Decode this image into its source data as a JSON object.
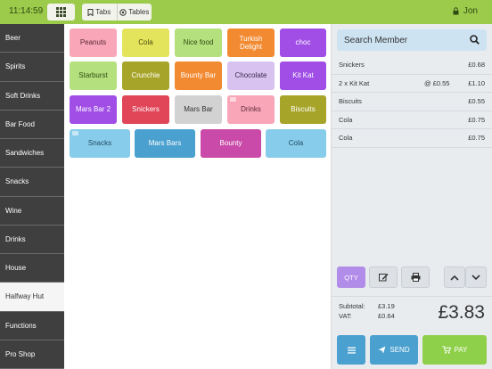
{
  "topbar": {
    "time": "11:14:59",
    "tabs_label": "Tabs",
    "tables_label": "Tables",
    "user_name": "Jon"
  },
  "sidebar": {
    "items": [
      {
        "label": "Beer"
      },
      {
        "label": "Spirits"
      },
      {
        "label": "Soft Drinks"
      },
      {
        "label": "Bar Food"
      },
      {
        "label": "Sandwiches"
      },
      {
        "label": "Snacks"
      },
      {
        "label": "Wine"
      },
      {
        "label": "Drinks"
      },
      {
        "label": "House"
      },
      {
        "label": "Halfway Hut",
        "active": true
      },
      {
        "label": "Functions"
      },
      {
        "label": "Pro Shop"
      }
    ]
  },
  "products": [
    {
      "label": "Peanuts",
      "color": "#f9a6b8",
      "text": "#5a2a35"
    },
    {
      "label": "Cola",
      "color": "#e4e45c",
      "text": "#4a4a10"
    },
    {
      "label": "Nice food",
      "color": "#b4e07e",
      "text": "#2f4a10"
    },
    {
      "label": "Turkish Delight",
      "color": "#f28a32",
      "text": "#ffffff"
    },
    {
      "label": "choc",
      "color": "#a04ee6",
      "text": "#ffffff"
    },
    {
      "label": "Starburst",
      "color": "#b4e07e",
      "text": "#2f4a10"
    },
    {
      "label": "Crunchie",
      "color": "#a7a42a",
      "text": "#ffffff"
    },
    {
      "label": "Bounty Bar",
      "color": "#f28a32",
      "text": "#ffffff"
    },
    {
      "label": "Chocolate",
      "color": "#d8c2ef",
      "text": "#3a2a50"
    },
    {
      "label": "Kit Kat",
      "color": "#a04ee6",
      "text": "#ffffff"
    },
    {
      "label": "Mars Bar 2",
      "color": "#a04ee6",
      "text": "#ffffff"
    },
    {
      "label": "Snickers",
      "color": "#e04558",
      "text": "#ffffff"
    },
    {
      "label": "Mars Bar",
      "color": "#d2d2d2",
      "text": "#333333"
    },
    {
      "label": "Drinks",
      "color": "#f9a6b8",
      "text": "#5a2a35",
      "folder": true
    },
    {
      "label": "Biscuits",
      "color": "#a7a42a",
      "text": "#ffffff"
    },
    {
      "label": "Snacks",
      "color": "#88cceb",
      "text": "#1f4a60",
      "folder": true
    },
    {
      "label": "Mars Bars",
      "color": "#4aa0cf",
      "text": "#ffffff"
    },
    {
      "label": "Bounty",
      "color": "#c94aa8",
      "text": "#ffffff"
    },
    {
      "label": "Cola",
      "color": "#88cceb",
      "text": "#1f4a60"
    }
  ],
  "order": {
    "search_placeholder": "Search Member",
    "lines": [
      {
        "desc": "Snickers",
        "unit": "",
        "amount": "£0.68"
      },
      {
        "desc": "2 x  Kit Kat",
        "unit": "@ £0.55",
        "amount": "£1.10"
      },
      {
        "desc": "Biscuits",
        "unit": "",
        "amount": "£0.55"
      },
      {
        "desc": "Cola",
        "unit": "",
        "amount": "£0.75"
      },
      {
        "desc": "Cola",
        "unit": "",
        "amount": "£0.75"
      }
    ],
    "qty_label": "QTY",
    "subtotal_label": "Subtotal:",
    "subtotal_value": "£3.19",
    "vat_label": "VAT:",
    "vat_value": "£0.64",
    "total": "£3.83",
    "send_label": "SEND",
    "pay_label": "PAY"
  }
}
